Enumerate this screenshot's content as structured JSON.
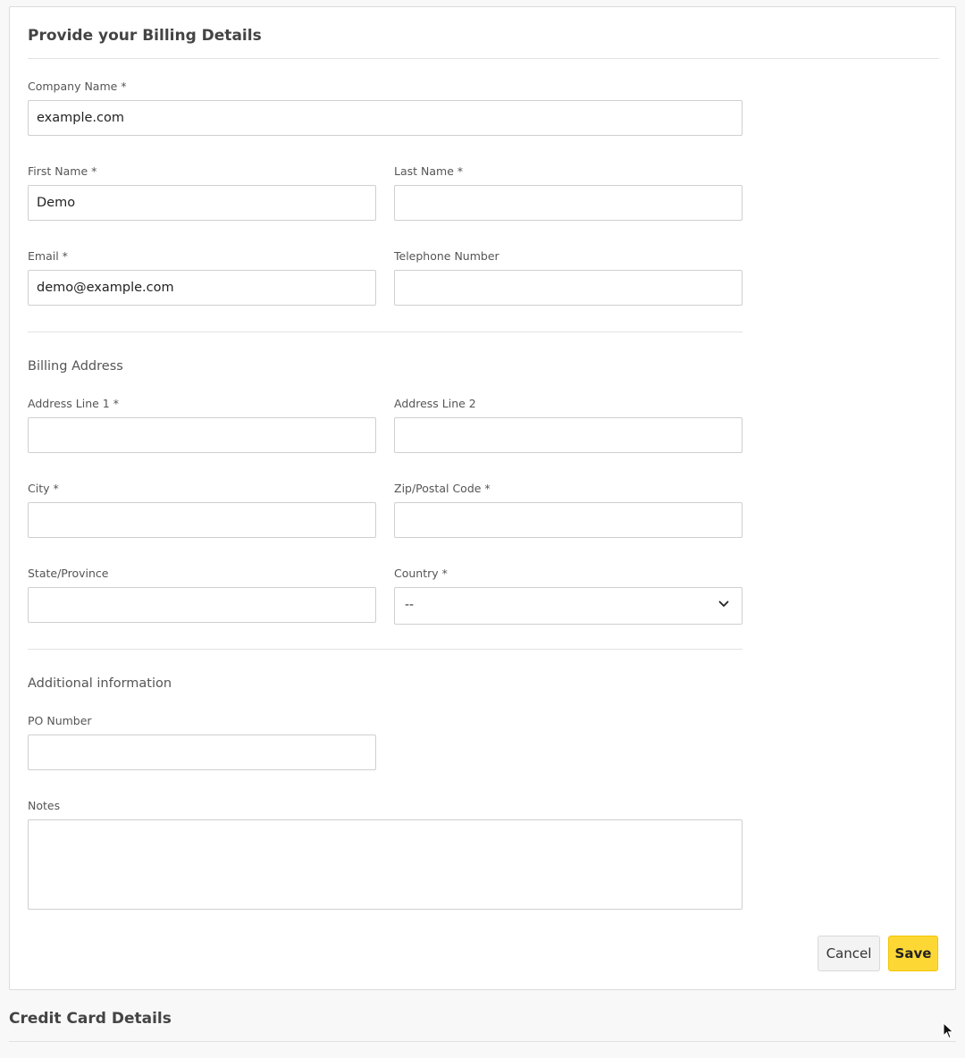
{
  "billing": {
    "title": "Provide your Billing Details",
    "company_name": {
      "label": "Company Name *",
      "value": "example.com"
    },
    "first_name": {
      "label": "First Name *",
      "value": "Demo"
    },
    "last_name": {
      "label": "Last Name *",
      "value": ""
    },
    "email": {
      "label": "Email *",
      "value": "demo@example.com"
    },
    "telephone": {
      "label": "Telephone Number",
      "value": ""
    },
    "address_section_title": "Billing Address",
    "address_line1": {
      "label": "Address Line 1 *",
      "value": ""
    },
    "address_line2": {
      "label": "Address Line 2",
      "value": ""
    },
    "city": {
      "label": "City *",
      "value": ""
    },
    "zip": {
      "label": "Zip/Postal Code *",
      "value": ""
    },
    "state": {
      "label": "State/Province",
      "value": ""
    },
    "country": {
      "label": "Country *",
      "selected": "--"
    },
    "additional_section_title": "Additional information",
    "po_number": {
      "label": "PO Number",
      "value": ""
    },
    "notes": {
      "label": "Notes",
      "value": ""
    },
    "cancel_label": "Cancel",
    "save_label": "Save",
    "save_color": "#fdd835"
  },
  "credit_card": {
    "title": "Credit Card Details"
  }
}
